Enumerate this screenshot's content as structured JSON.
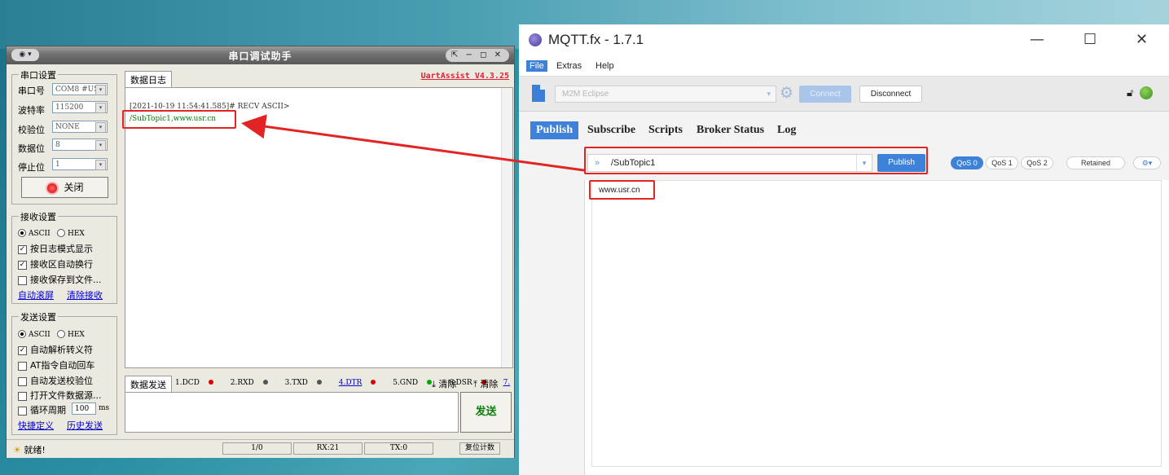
{
  "serial_assistant": {
    "title": "串口调试助手",
    "sys_menu": "◉ ▾",
    "title_buttons": "⇱ − ◻ ✕",
    "version": "UartAssist V4.3.25",
    "port_settings": {
      "group_title": "串口设置",
      "port_label": "串口号",
      "port_value": "COM8 #USI",
      "baud_label": "波特率",
      "baud_value": "115200",
      "parity_label": "校验位",
      "parity_value": "NONE",
      "databits_label": "数据位",
      "databits_value": "8",
      "stopbits_label": "停止位",
      "stopbits_value": "1",
      "close_button": "关闭"
    },
    "receive_settings": {
      "group_title": "接收设置",
      "ascii": "ASCII",
      "hex": "HEX",
      "opt1": "按日志模式显示",
      "opt2": "接收区自动换行",
      "opt3": "接收保存到文件...",
      "link1": "自动滚屏",
      "link2": "清除接收"
    },
    "send_settings": {
      "group_title": "发送设置",
      "ascii": "ASCII",
      "hex": "HEX",
      "opt1": "自动解析转义符",
      "opt2": "AT指令自动回车",
      "opt3": "自动发送校验位",
      "opt4": "打开文件数据源...",
      "opt5": "循环周期",
      "period_value": "100",
      "period_unit": "ms",
      "link1": "快捷定义",
      "link2": "历史发送"
    },
    "log_tab": "数据日志",
    "log_lines": [
      "[2021-10-19 11:54:41.585]# RECV ASCII>",
      "/SubTopic1,www.usr.cn"
    ],
    "send_tab": "数据发送",
    "pins": [
      "1.DCD",
      "2.RXD",
      "3.TXD",
      "4.DTR",
      "5.GND",
      "6.DSR",
      "7."
    ],
    "clear1": "清除",
    "clear2": "清除",
    "send_button": "发送",
    "status": {
      "ready": "就绪!",
      "count": "1/0",
      "rx": "RX:21",
      "tx": "TX:0",
      "reset": "复位计数"
    }
  },
  "mqtt": {
    "title": "MQTT.fx - 1.7.1",
    "window_buttons": [
      "—",
      "☐",
      "✕"
    ],
    "menu": [
      "File",
      "Extras",
      "Help"
    ],
    "profile": "M2M Eclipse",
    "connect_button": "Connect",
    "disconnect_button": "Disconnect",
    "tabs": [
      "Publish",
      "Subscribe",
      "Scripts",
      "Broker Status",
      "Log"
    ],
    "topic": "/SubTopic1",
    "publish_button": "Publish",
    "qos": [
      "QoS 0",
      "QoS 1",
      "QoS 2"
    ],
    "retained": "Retained",
    "options_icon": "⚙▾",
    "payload": "www.usr.cn"
  },
  "colors": {
    "annotation": "#e32424",
    "mqtt_accent": "#3d82d8",
    "serial_recv_text": "#007a00"
  }
}
